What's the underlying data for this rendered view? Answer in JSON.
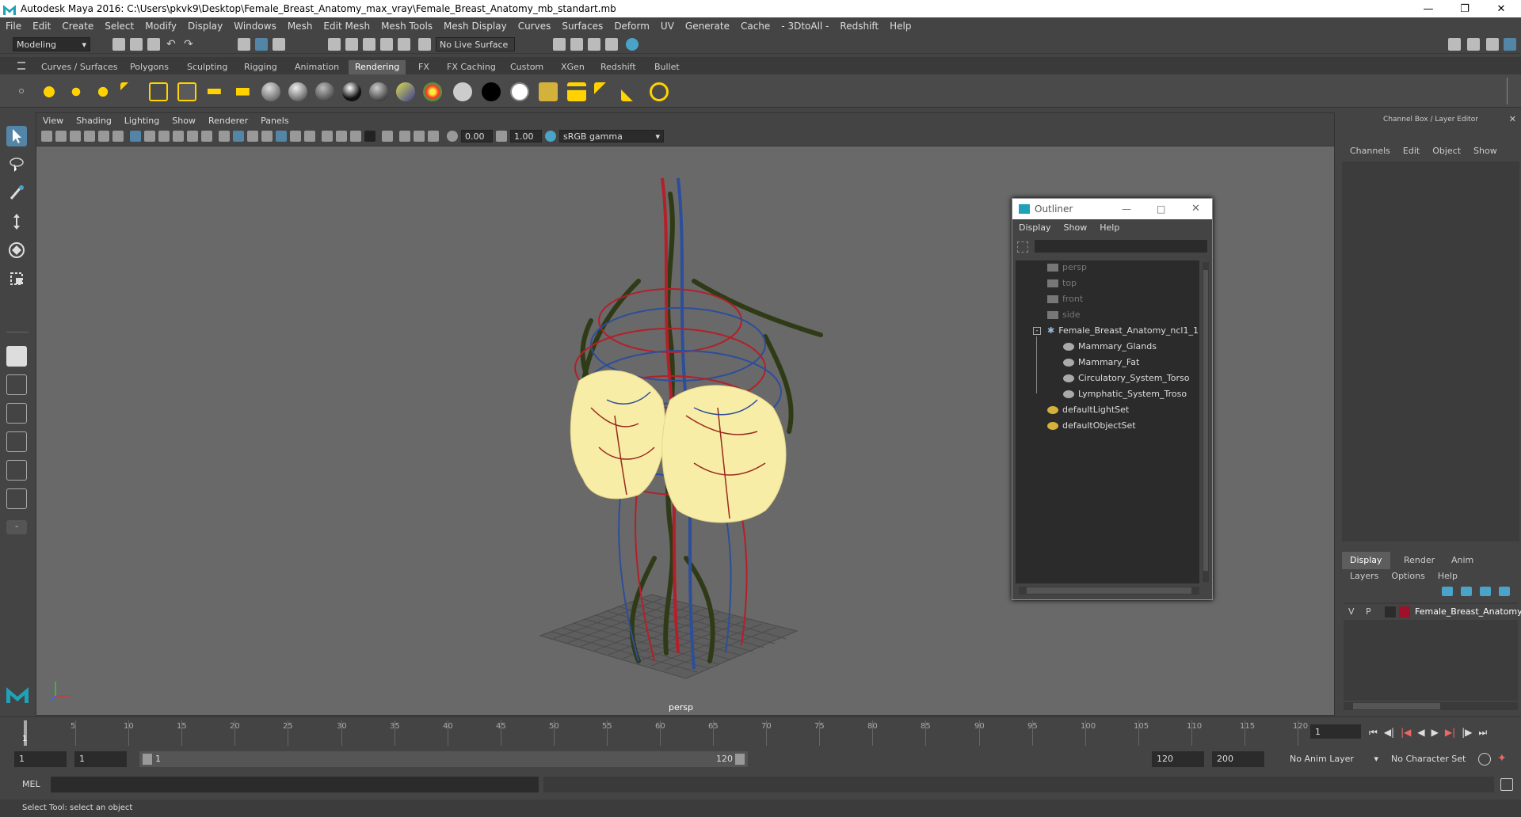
{
  "window": {
    "title": "Autodesk Maya 2016: C:\\Users\\pkvk9\\Desktop\\Female_Breast_Anatomy_max_vray\\Female_Breast_Anatomy_mb_standart.mb"
  },
  "menu": [
    "File",
    "Edit",
    "Create",
    "Select",
    "Modify",
    "Display",
    "Windows",
    "Mesh",
    "Edit Mesh",
    "Mesh Tools",
    "Mesh Display",
    "Curves",
    "Surfaces",
    "Deform",
    "UV",
    "Generate",
    "Cache",
    "- 3DtoAll -",
    "Redshift",
    "Help"
  ],
  "status": {
    "mode": "Modeling",
    "live_surface": "No Live Surface"
  },
  "shelf": {
    "tabs": [
      "Curves / Surfaces",
      "Polygons",
      "Sculpting",
      "Rigging",
      "Animation",
      "Rendering",
      "FX",
      "FX Caching",
      "Custom",
      "XGen",
      "Redshift",
      "Bullet"
    ],
    "active": "Rendering"
  },
  "viewport": {
    "menu": [
      "View",
      "Shading",
      "Lighting",
      "Show",
      "Renderer",
      "Panels"
    ],
    "exposure": "0.00",
    "gamma": "1.00",
    "color_space": "sRGB gamma",
    "camera": "persp"
  },
  "outliner": {
    "title": "Outliner",
    "menu": [
      "Display",
      "Show",
      "Help"
    ],
    "items": [
      {
        "label": "persp",
        "dim": true
      },
      {
        "label": "top",
        "dim": true
      },
      {
        "label": "front",
        "dim": true
      },
      {
        "label": "side",
        "dim": true
      },
      {
        "label": "Female_Breast_Anatomy_ncl1_1",
        "dim": false
      },
      {
        "label": "Mammary_Glands",
        "dim": false
      },
      {
        "label": "Mammary_Fat",
        "dim": false
      },
      {
        "label": "Circulatory_System_Torso",
        "dim": false
      },
      {
        "label": "Lymphatic_System_Troso",
        "dim": false
      },
      {
        "label": "defaultLightSet",
        "dim": false
      },
      {
        "label": "defaultObjectSet",
        "dim": false
      }
    ]
  },
  "channelbox": {
    "title": "Channel Box / Layer Editor",
    "menu": [
      "Channels",
      "Edit",
      "Object",
      "Show"
    ]
  },
  "layers": {
    "tabs": [
      "Display",
      "Render",
      "Anim"
    ],
    "active": "Display",
    "menu": [
      "Layers",
      "Options",
      "Help"
    ],
    "row": {
      "v": "V",
      "p": "P",
      "name": "Female_Breast_Anatomy",
      "color": "#a0102a"
    }
  },
  "timeline": {
    "ticks": [
      "5",
      "10",
      "15",
      "20",
      "25",
      "30",
      "35",
      "40",
      "45",
      "50",
      "55",
      "60",
      "65",
      "70",
      "75",
      "80",
      "85",
      "90",
      "95",
      "100",
      "105",
      "110",
      "115",
      "120"
    ],
    "start_marker": "1",
    "current_frame": "1"
  },
  "range": {
    "start": "1",
    "playback_start": "1",
    "slider_start": "1",
    "slider_end": "120",
    "playback_end": "120",
    "end": "200",
    "anim_layer": "No Anim Layer",
    "character_set": "No Character Set"
  },
  "command": {
    "label": "MEL"
  },
  "help_line": "Select Tool: select an object",
  "colors": {
    "accent": "#5285a6",
    "bg": "#444444",
    "viewport": "#696969"
  }
}
